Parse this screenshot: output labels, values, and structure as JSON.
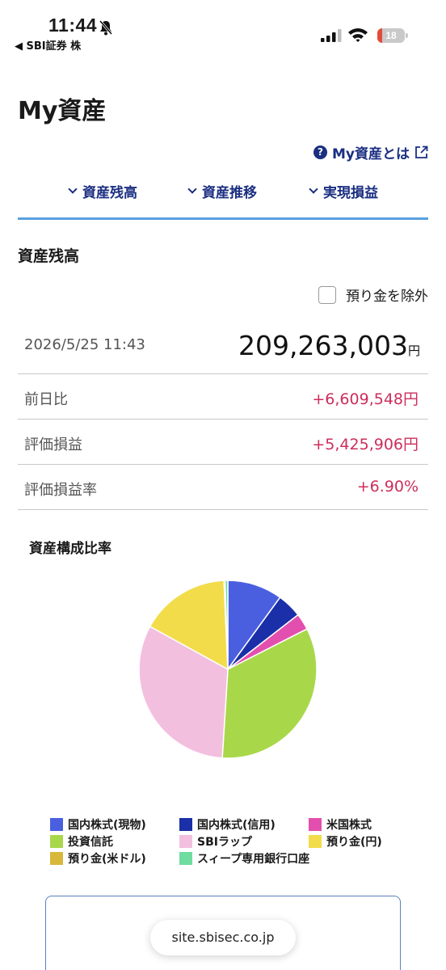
{
  "status_bar": {
    "time": "11:44",
    "back_app": "◀ SBI証券 株",
    "battery": "18",
    "battery_level": 0.18
  },
  "page": {
    "title": "My資産",
    "help_link": "My資産とは"
  },
  "tabs": [
    {
      "label": "資産残高"
    },
    {
      "label": "資産推移"
    },
    {
      "label": "実現損益"
    }
  ],
  "section": {
    "title": "資産残高",
    "exclude_label": "預り金を除外"
  },
  "summary": {
    "date": "2026/5/25 11:43",
    "total": "209,263,003",
    "total_unit": "円",
    "rows": [
      {
        "label": "前日比",
        "value": "+6,609,548円"
      },
      {
        "label": "評価損益",
        "value": "+5,425,906円"
      },
      {
        "label": "評価損益率",
        "value": "+6.90%"
      }
    ]
  },
  "chart_title": "資産構成比率",
  "chart_data": {
    "type": "pie",
    "slices": [
      {
        "name": "国内株式(現物)",
        "value": 10.0,
        "color": "#4a5fe0"
      },
      {
        "name": "国内株式(信用)",
        "value": 4.5,
        "color": "#1a2fa8"
      },
      {
        "name": "米国株式",
        "value": 3.0,
        "color": "#e34fae"
      },
      {
        "name": "投資信託",
        "value": 33.5,
        "color": "#a8d84a"
      },
      {
        "name": "SBIラップ",
        "value": 32.0,
        "color": "#f3bfdf"
      },
      {
        "name": "預り金(円)",
        "value": 16.3,
        "color": "#f2dc4a"
      },
      {
        "name": "預り金(米ドル)",
        "value": 0.2,
        "color": "#d8b83a"
      },
      {
        "name": "スィープ専用銀行口座",
        "value": 0.5,
        "color": "#6fdca0"
      }
    ]
  },
  "footer": {
    "url": "site.sbisec.co.jp"
  }
}
